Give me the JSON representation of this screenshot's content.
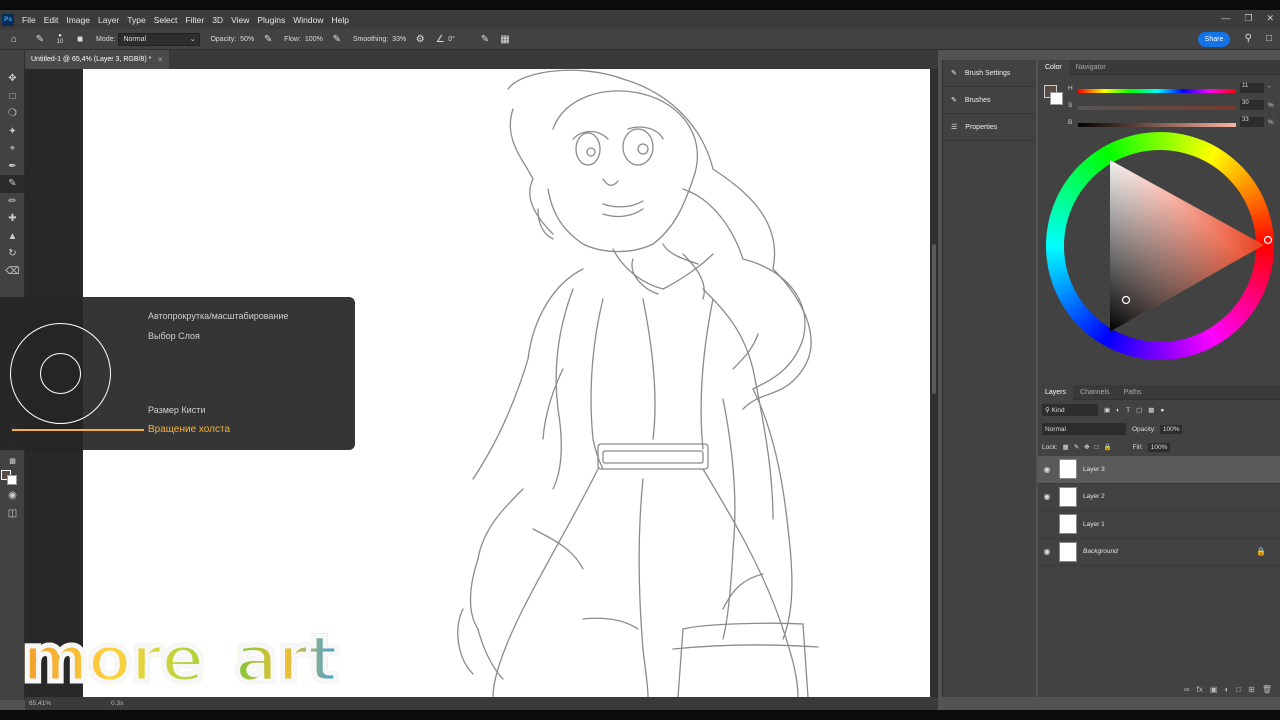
{
  "app": {
    "logo": "Ps"
  },
  "menu": [
    "File",
    "Edit",
    "Image",
    "Layer",
    "Type",
    "Select",
    "Filter",
    "3D",
    "View",
    "Plugins",
    "Window",
    "Help"
  ],
  "options": {
    "mode_label": "Mode:",
    "mode_value": "Normal",
    "opacity_label": "Opacity:",
    "opacity_value": "50%",
    "flow_label": "Flow:",
    "flow_value": "100%",
    "smoothing_label": "Smoothing:",
    "smoothing_value": "33%",
    "angle_value": "0°",
    "brush_size": "10",
    "share_label": "Share"
  },
  "document": {
    "tab_title": "Untitled-1 @ 65,4% (Layer 3, RGB/8) *"
  },
  "status": {
    "zoom": "65,41%",
    "time": "0.3s"
  },
  "radial_menu": {
    "item1": "Автопрокрутка/масштабирование",
    "item2": "Выбор Слоя",
    "item3": "Размер Кисти",
    "item4": "Вращение холста",
    "highlight_color": "#f2b23a"
  },
  "side_panel": {
    "items": [
      "Brush Settings",
      "Brushes",
      "Properties"
    ]
  },
  "color_panel": {
    "tabs": [
      "Color",
      "Navigator"
    ],
    "h_label": "H",
    "h_value": "11",
    "s_label": "S",
    "s_value": "30",
    "s_pct": "%",
    "b_label": "B",
    "b_value": "33",
    "b_pct": "%",
    "foreground": "#5b4a45"
  },
  "layers_panel": {
    "tabs": [
      "Layers",
      "Channels",
      "Paths"
    ],
    "kind_label": "Kind",
    "blend_mode": "Normal",
    "opacity_label": "Opacity:",
    "opacity_value": "100%",
    "lock_label": "Lock:",
    "fill_label": "Fill:",
    "fill_value": "100%",
    "layers": [
      {
        "name": "Layer 3",
        "visible": true,
        "selected": true
      },
      {
        "name": "Layer 2",
        "visible": true,
        "selected": false
      },
      {
        "name": "Layer 1",
        "visible": false,
        "selected": false
      },
      {
        "name": "Background",
        "visible": true,
        "selected": false,
        "locked": true
      }
    ]
  },
  "watermark": {
    "word1": "more",
    "word2": "art"
  }
}
